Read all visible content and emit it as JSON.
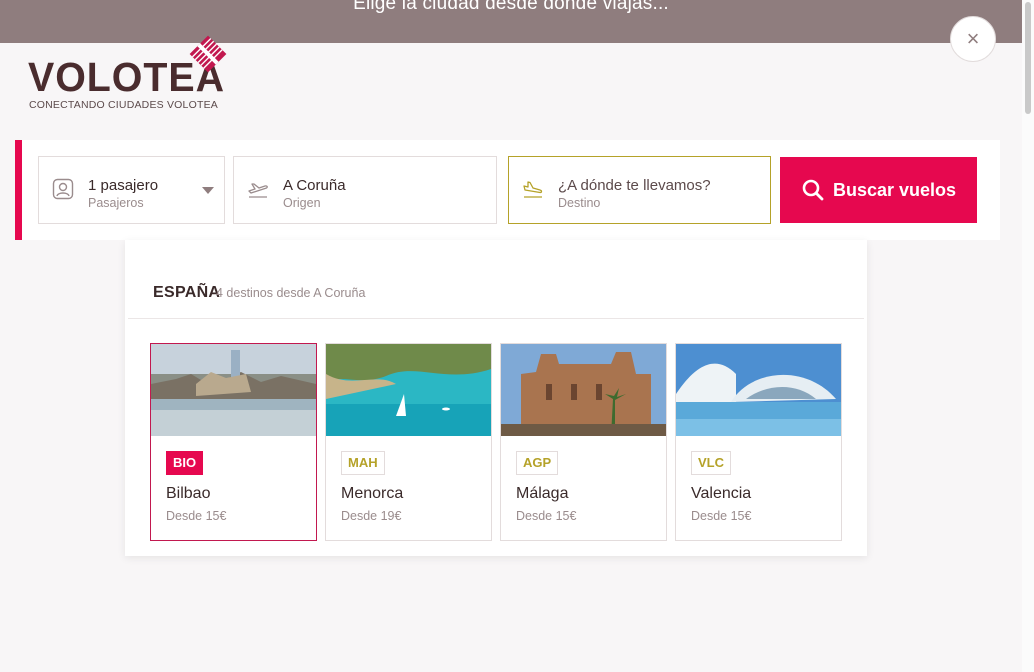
{
  "topbar": {
    "message": "Elige la ciudad desde donde viajas..."
  },
  "close": {
    "label": "×",
    "icon": "close-icon"
  },
  "logo": {
    "name": "VOLOTEA",
    "tagline": "CONECTANDO CIUDADES VOLOTEA",
    "accent": "#c2184f"
  },
  "search": {
    "passengers": {
      "value": "1 pasajero",
      "label": "Pasajeros",
      "icon": "user-icon"
    },
    "origin": {
      "value": "A Coruña",
      "label": "Origen",
      "icon": "plane-takeoff-icon"
    },
    "destination": {
      "placeholder": "¿A dónde te llevamos?",
      "label": "Destino",
      "icon": "plane-landing-icon"
    },
    "button_label": "Buscar vuelos",
    "button_icon": "search-icon",
    "accent_color": "#e6084f"
  },
  "dropdown": {
    "country": "ESPAÑA",
    "count_text": "4 destinos desde A Coruña",
    "destinations": [
      {
        "code": "BIO",
        "city": "Bilbao",
        "price": "Desde 15€",
        "selected": true
      },
      {
        "code": "MAH",
        "city": "Menorca",
        "price": "Desde 19€",
        "selected": false
      },
      {
        "code": "AGP",
        "city": "Málaga",
        "price": "Desde 15€",
        "selected": false
      },
      {
        "code": "VLC",
        "city": "Valencia",
        "price": "Desde 15€",
        "selected": false
      }
    ]
  }
}
